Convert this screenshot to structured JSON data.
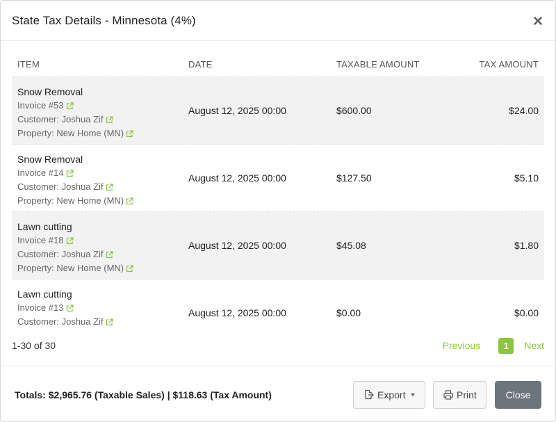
{
  "modal": {
    "title": "State Tax Details - Minnesota (4%)",
    "close_symbol": "×"
  },
  "table": {
    "headers": {
      "item": "ITEM",
      "date": "DATE",
      "taxable": "TAXABLE AMOUNT",
      "tax": "TAX AMOUNT"
    },
    "rows": [
      {
        "name": "Snow Removal",
        "invoice": "Invoice #53",
        "customer": "Customer: Joshua Zif",
        "property": "Property: New Home (MN)",
        "date": "August 12, 2025 00:00",
        "taxable": "$600.00",
        "tax": "$24.00"
      },
      {
        "name": "Snow Removal",
        "invoice": "Invoice #14",
        "customer": "Customer: Joshua Zif",
        "property": "Property: New Home (MN)",
        "date": "August 12, 2025 00:00",
        "taxable": "$127.50",
        "tax": "$5.10"
      },
      {
        "name": "Lawn cutting",
        "invoice": "Invoice #18",
        "customer": "Customer: Joshua Zif",
        "property": "Property: New Home (MN)",
        "date": "August 12, 2025 00:00",
        "taxable": "$45.08",
        "tax": "$1.80"
      },
      {
        "name": "Lawn cutting",
        "invoice": "Invoice #13",
        "customer": "Customer: Joshua Zif",
        "property": "",
        "date": "August 12, 2025 00:00",
        "taxable": "$0.00",
        "tax": "$0.00"
      }
    ]
  },
  "pagination": {
    "count": "1-30 of 30",
    "previous": "Previous",
    "current": "1",
    "next": "Next"
  },
  "footer": {
    "totals": "Totals: $2,965.76 (Taxable Sales) | $118.63 (Tax Amount)",
    "export_label": "Export",
    "print_label": "Print",
    "close_label": "Close"
  },
  "colors": {
    "accent": "#8cc63f",
    "close_button": "#6c757d",
    "row_shade": "#f2f2f2"
  }
}
